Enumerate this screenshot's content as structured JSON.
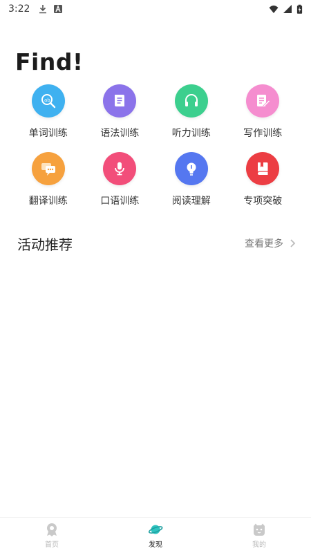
{
  "status_bar": {
    "time": "3:22",
    "icons": [
      "download-icon",
      "a-icon",
      "wifi-icon",
      "signal-icon",
      "battery-icon"
    ]
  },
  "page": {
    "title": "Find!"
  },
  "training_grid": [
    {
      "label": "单词训练",
      "icon": "word-search-icon",
      "color": "#3fb1f0"
    },
    {
      "label": "语法训练",
      "icon": "grammar-document-icon",
      "color": "#8b73ea"
    },
    {
      "label": "听力训练",
      "icon": "headphones-icon",
      "color": "#3ccf8e"
    },
    {
      "label": "写作训练",
      "icon": "writing-icon",
      "color": "#f58dcf"
    },
    {
      "label": "翻译训练",
      "icon": "chat-bubbles-icon",
      "color": "#f6a13e"
    },
    {
      "label": "口语训练",
      "icon": "microphone-icon",
      "color": "#f24e7a"
    },
    {
      "label": "阅读理解",
      "icon": "lightbulb-icon",
      "color": "#5577f0"
    },
    {
      "label": "专项突破",
      "icon": "book-icon",
      "color": "#ec3d43"
    }
  ],
  "activities": {
    "title": "活动推荐",
    "more_label": "查看更多"
  },
  "bottom_nav": [
    {
      "label": "首页",
      "icon": "home-icon",
      "active": false
    },
    {
      "label": "发现",
      "icon": "planet-icon",
      "active": true
    },
    {
      "label": "我的",
      "icon": "profile-face-icon",
      "active": false
    }
  ],
  "colors": {
    "accent": "#2ec4c0",
    "inactive": "#b8b8b8",
    "text": "#222222"
  }
}
